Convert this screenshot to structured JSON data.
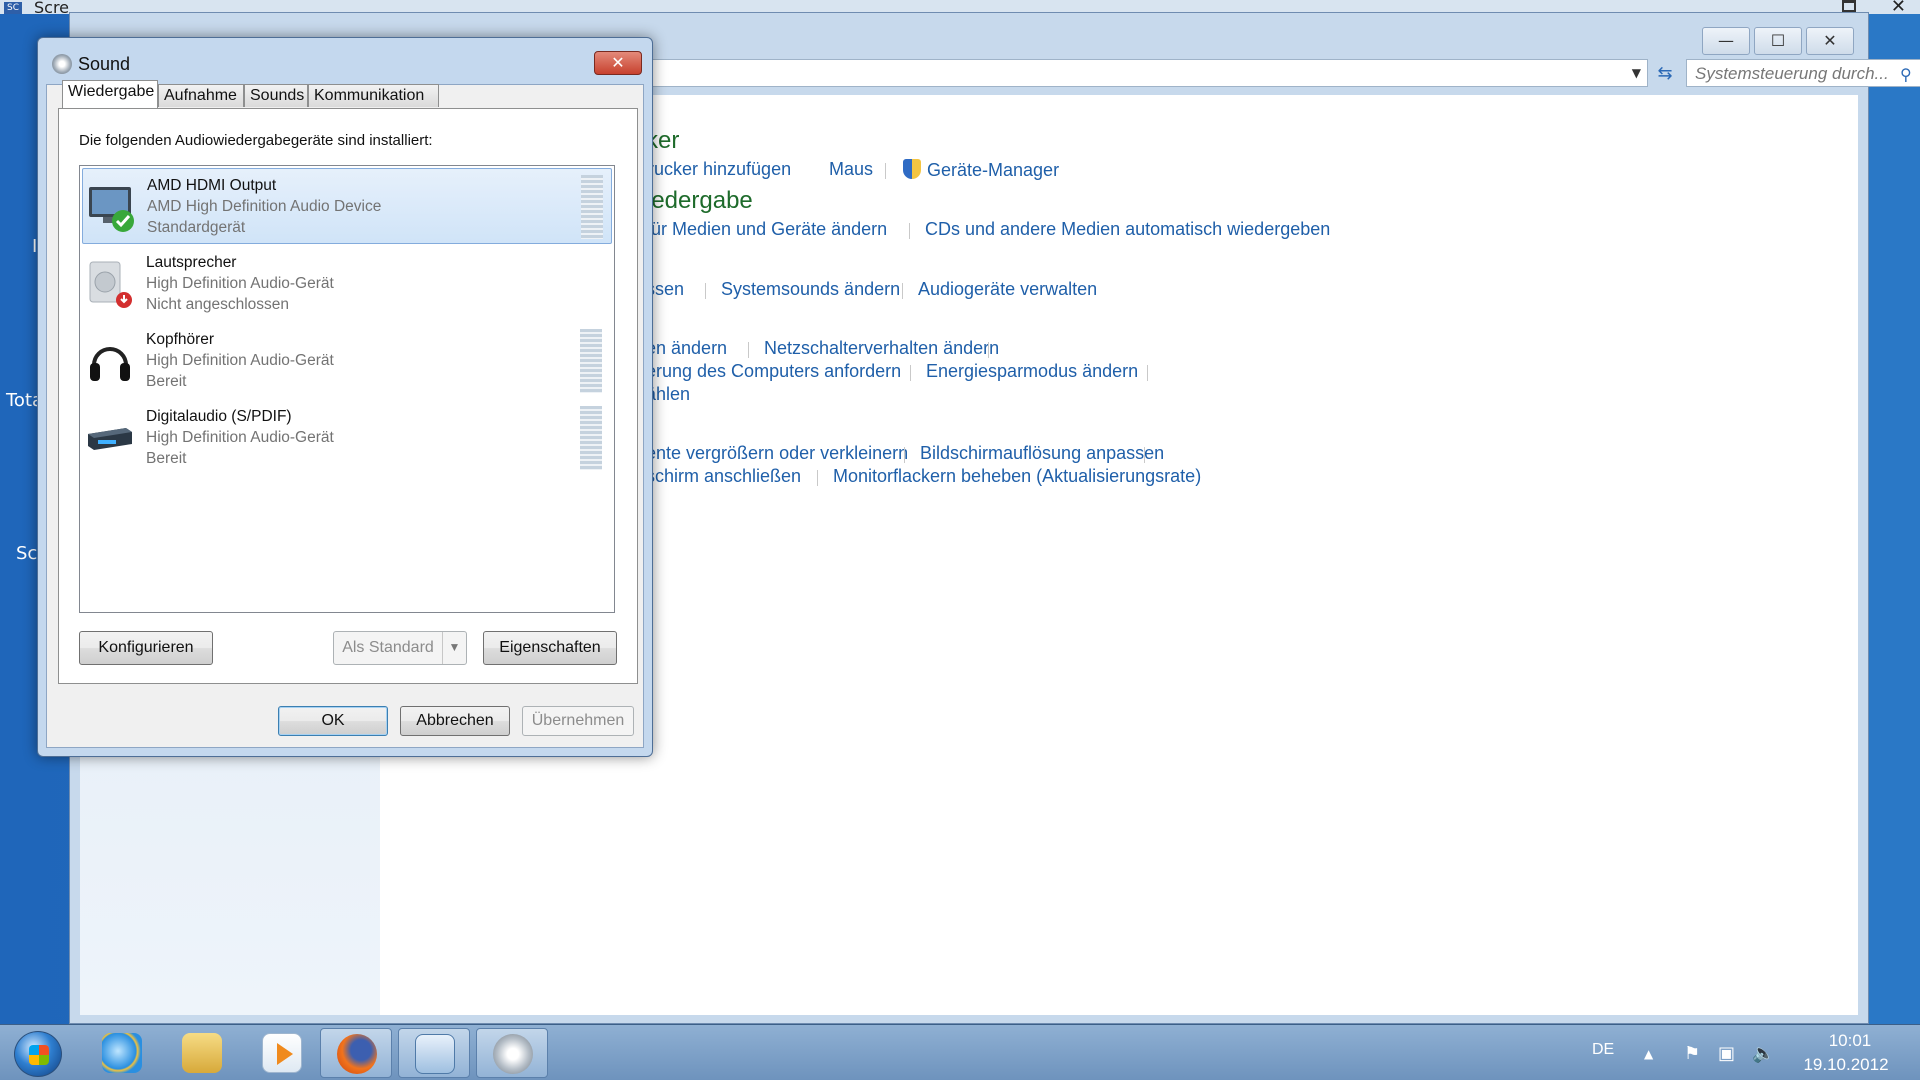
{
  "desktop": {
    "labels": [
      "I",
      "Tota",
      "Sc"
    ]
  },
  "bg_window": {
    "title": "Scre",
    "close": "✕"
  },
  "control_panel": {
    "buttons": {
      "minimize": "—",
      "maximize": "☐",
      "close": "✕"
    },
    "search_placeholder": "Systemsteuerung durch...",
    "sections": [
      {
        "heading": "ker",
        "links": [
          "Drucker hinzufügen",
          "Maus",
          "Geräte-Manager"
        ]
      },
      {
        "heading": "iedergabe",
        "links": [
          " für Medien und Geräte ändern",
          "CDs und andere Medien automatisch wiedergeben"
        ]
      },
      {
        "links": [
          "ssen",
          "Systemsounds ändern",
          "Audiogeräte verwalten"
        ]
      },
      {
        "links": [
          "en ändern",
          "Netzschalterverhalten ändern"
        ]
      },
      {
        "links": [
          "erung des Computers anfordern",
          "Energiesparmodus ändern"
        ]
      },
      {
        "links": [
          "ählen"
        ]
      },
      {
        "links": [
          "ente vergrößern oder verkleinern",
          "Bildschirmauflösung anpassen"
        ]
      },
      {
        "links": [
          "schirm anschließen",
          "Monitorflackern beheben (Aktualisierungsrate)"
        ]
      }
    ]
  },
  "sound_dialog": {
    "title": "Sound",
    "close": "✕",
    "tabs": [
      "Wiedergabe",
      "Aufnahme",
      "Sounds",
      "Kommunikation"
    ],
    "active_tab": "Wiedergabe",
    "description": "Die folgenden Audiowiedergabegeräte sind installiert:",
    "devices": [
      {
        "name": "AMD HDMI Output",
        "driver": "AMD High Definition Audio Device",
        "status": "Standardgerät",
        "icon": "monitor-icon",
        "badge": "default-check-icon"
      },
      {
        "name": "Lautsprecher",
        "driver": "High Definition Audio-Gerät",
        "status": "Nicht angeschlossen",
        "icon": "speaker-icon",
        "badge": "unplugged-icon"
      },
      {
        "name": "Kopfhörer",
        "driver": "High Definition Audio-Gerät",
        "status": "Bereit",
        "icon": "headphones-icon"
      },
      {
        "name": "Digitalaudio (S/PDIF)",
        "driver": "High Definition Audio-Gerät",
        "status": "Bereit",
        "icon": "digital-audio-icon"
      }
    ],
    "buttons": {
      "configure": "Konfigurieren",
      "set_default": "Als Standard",
      "properties": "Eigenschaften",
      "ok": "OK",
      "cancel": "Abbrechen",
      "apply": "Übernehmen"
    }
  },
  "taskbar": {
    "language": "DE",
    "time": "10:01",
    "date": "19.10.2012",
    "apps": [
      "internet-explorer-icon",
      "explorer-folder-icon",
      "media-player-icon",
      "firefox-icon",
      "control-panel-icon",
      "sound-icon"
    ]
  }
}
